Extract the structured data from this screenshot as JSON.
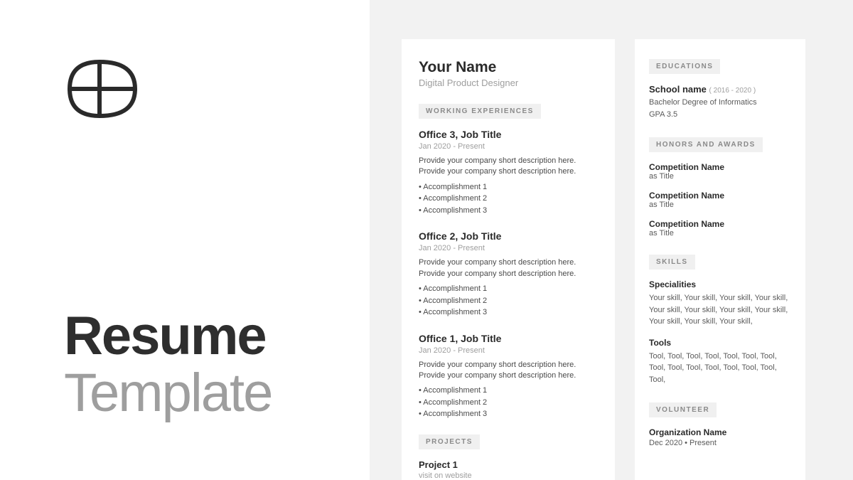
{
  "cover": {
    "line1": "Resume",
    "line2": "Template"
  },
  "resume": {
    "name": "Your Name",
    "role": "Digital Product Designer",
    "sections": {
      "work_label": "WORKING EXPERIENCES",
      "projects_label": "PROJECTS",
      "educations_label": "EDUCATIONS",
      "honors_label": "HONORS AND AWARDS",
      "skills_label": "SKILLS",
      "volunteer_label": "VOLUNTEER"
    },
    "jobs": [
      {
        "title": "Office 3, Job Title",
        "dates": "Jan 2020 -  Present",
        "desc": "Provide your company short description here. Provide your company short description here.",
        "acc1": "• Accomplishment 1",
        "acc2": "• Accomplishment 2",
        "acc3": "• Accomplishment 3"
      },
      {
        "title": "Office 2, Job Title",
        "dates": "Jan 2020 -  Present",
        "desc": "Provide your company short description here. Provide your company short description here.",
        "acc1": "• Accomplishment 1",
        "acc2": "• Accomplishment 2",
        "acc3": "• Accomplishment 3"
      },
      {
        "title": "Office 1, Job Title",
        "dates": "Jan 2020 -  Present",
        "desc": "Provide your company short description here. Provide your company short description here.",
        "acc1": "• Accomplishment 1",
        "acc2": "• Accomplishment 2",
        "acc3": "• Accomplishment 3"
      }
    ],
    "project": {
      "title": "Project 1",
      "sub": "visit on website"
    },
    "education": {
      "school": "School name",
      "years": "( 2016 - 2020 )",
      "degree": "Bachelor Degree of Informatics",
      "gpa": "GPA 3.5"
    },
    "honors": [
      {
        "name": "Competition Name",
        "role": "as Title"
      },
      {
        "name": "Competition Name",
        "role": "as Title"
      },
      {
        "name": "Competition Name",
        "role": "as Title"
      }
    ],
    "skills": {
      "spec_head": "Specialities",
      "spec_body": "Your skill, Your skill, Your skill, Your skill, Your skill, Your skill, Your skill, Your skill, Your skill, Your skill, Your skill,",
      "tools_head": "Tools",
      "tools_body": "Tool, Tool, Tool, Tool, Tool, Tool, Tool, Tool, Tool, Tool, Tool, Tool, Tool, Tool, Tool,"
    },
    "volunteer": {
      "org": "Organization Name",
      "dates": "Dec 2020 • Present"
    }
  }
}
